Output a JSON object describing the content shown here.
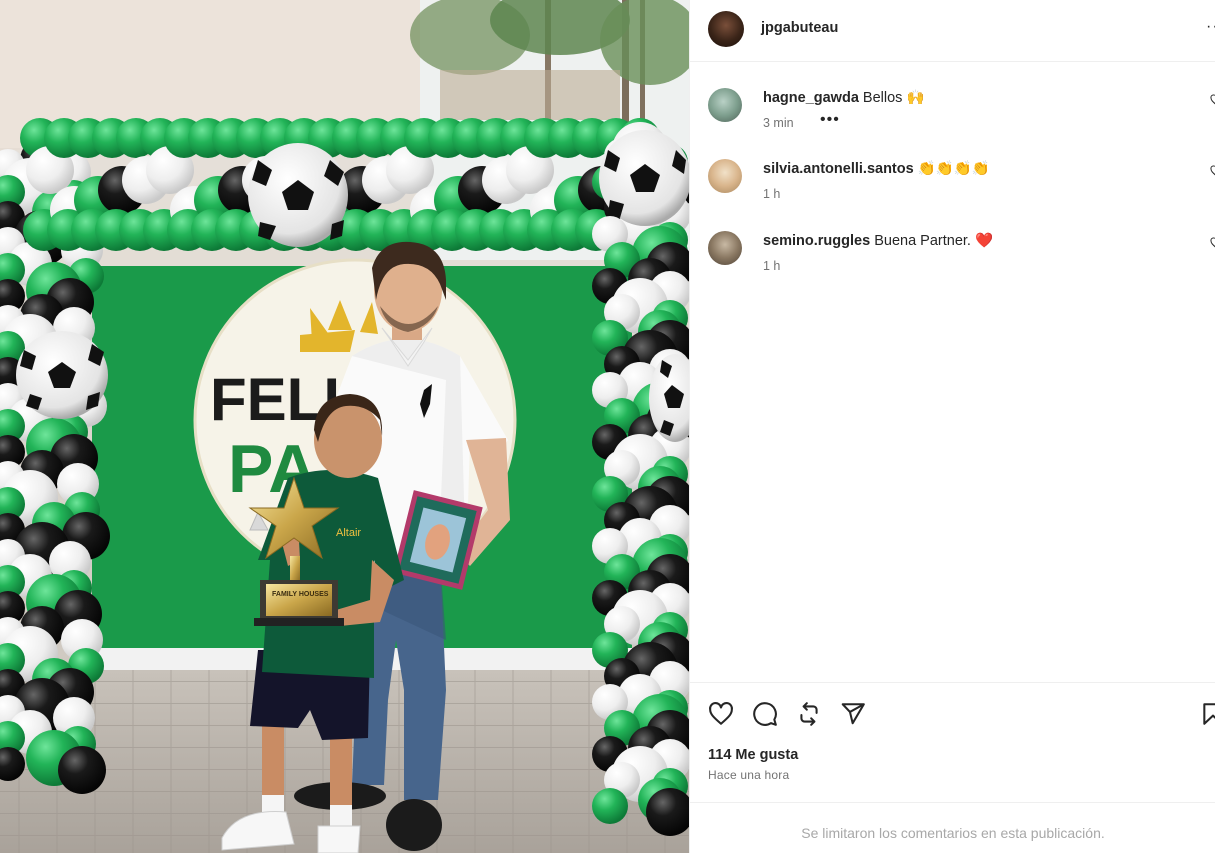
{
  "post": {
    "author": "jpgabuteau",
    "more_label": "···"
  },
  "photo": {
    "banner_text_1": "FELIZ",
    "banner_text_2": "PA",
    "trophy_plate_text": "FAMILY HOUSES",
    "shirt_logo_text": "Altair"
  },
  "comments": [
    {
      "user": "hagne_gawda",
      "text": "Bellos 🙌",
      "time": "3 min",
      "more": "•••"
    },
    {
      "user": "silvia.antonelli.santos",
      "text": "👏👏👏👏",
      "time": "1 h"
    },
    {
      "user": "semino.ruggles",
      "text": "Buena Partner. ❤️",
      "time": "1 h"
    }
  ],
  "actions": {
    "icons": [
      "heart-icon",
      "comment-icon",
      "repost-icon",
      "share-icon",
      "bookmark-icon"
    ],
    "likes": "114 Me gusta",
    "time": "Hace una hora"
  },
  "footer": {
    "notice": "Se limitaron los comentarios en esta publicación."
  },
  "colors": {
    "banner_green": "#1a9a4a",
    "balloon_green": "#21b457",
    "balloon_black": "#151515",
    "heart_red": "#ed4956",
    "text_secondary": "#737373"
  }
}
